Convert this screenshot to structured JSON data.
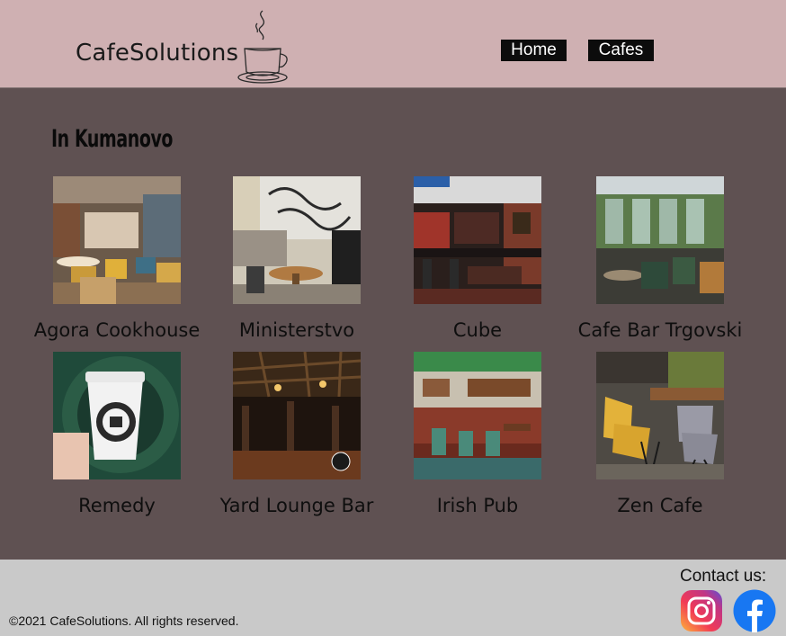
{
  "header": {
    "logo_text": "CafeSolutions",
    "nav": [
      {
        "label": "Home"
      },
      {
        "label": "Cafes"
      }
    ]
  },
  "main": {
    "city_title": "In Kumanovo",
    "cafes": [
      {
        "name": "Agora Cookhouse"
      },
      {
        "name": "Ministerstvo"
      },
      {
        "name": "Cube"
      },
      {
        "name": "Cafe Bar Trgovski"
      },
      {
        "name": "Remedy"
      },
      {
        "name": "Yard Lounge Bar"
      },
      {
        "name": "Irish Pub"
      },
      {
        "name": "Zen Cafe"
      }
    ]
  },
  "footer": {
    "copyright": "©2021 CafeSolutions. All rights reserved.",
    "contact_label": "Contact us:",
    "social": [
      {
        "icon": "instagram-icon"
      },
      {
        "icon": "facebook-icon"
      }
    ]
  },
  "colors": {
    "header_bg": "#cfb0b2",
    "main_bg": "#5f5152",
    "footer_bg": "#c9c9c9",
    "nav_bg": "#0c0c0c",
    "facebook_blue": "#1877f2"
  }
}
